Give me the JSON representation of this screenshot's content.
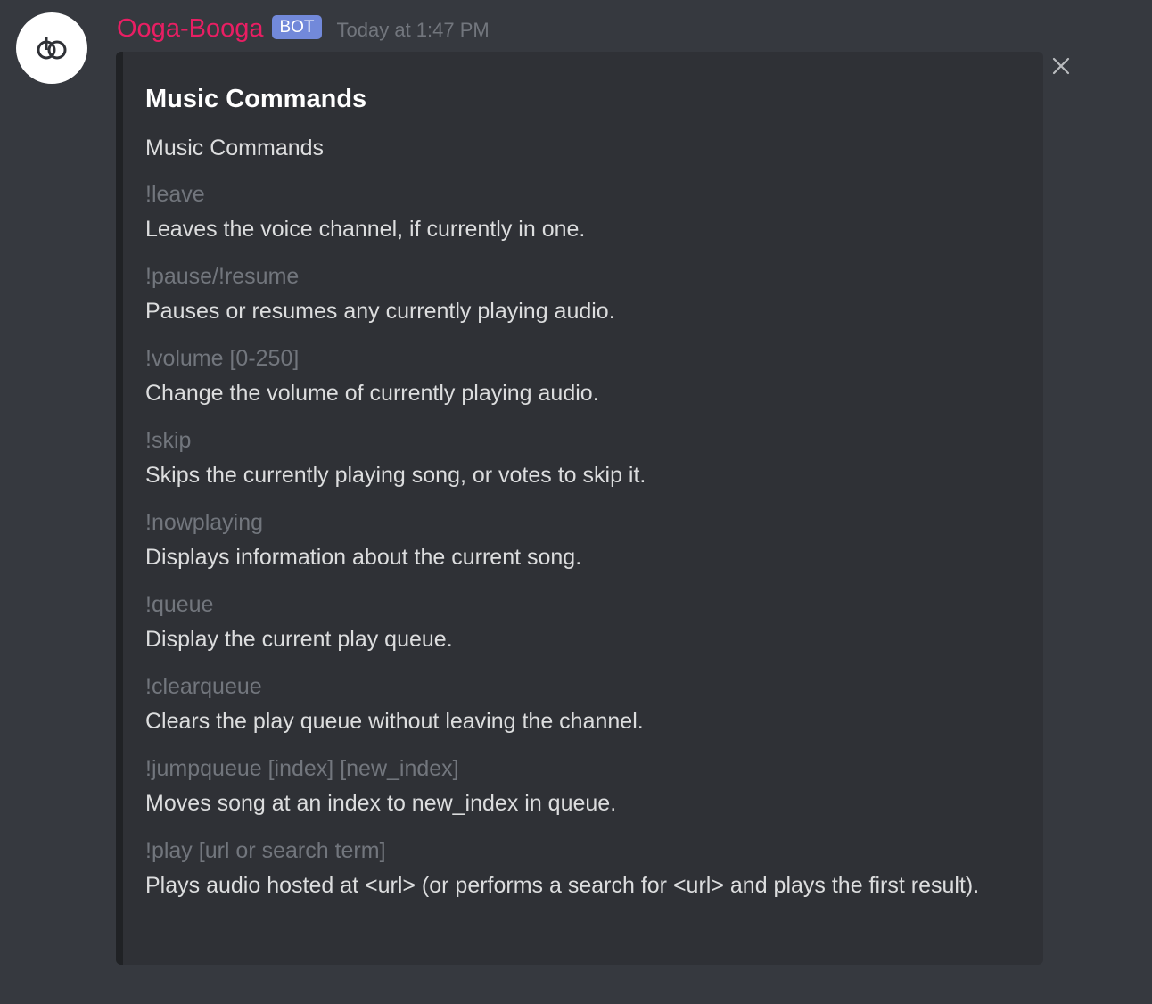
{
  "message": {
    "author": {
      "username": "Ooga-Booga",
      "tag": "BOT",
      "avatar_icon": "linked-rings-logo-icon",
      "username_color": "#e91e63",
      "tag_color": "#7289da"
    },
    "timestamp": "Today at 1:47 PM"
  },
  "embed": {
    "title": "Music Commands",
    "description": "Music Commands",
    "fields": [
      {
        "name": "!leave",
        "value": "Leaves the voice channel, if currently in one."
      },
      {
        "name": "!pause/!resume",
        "value": "Pauses or resumes any currently playing audio."
      },
      {
        "name": "!volume [0-250]",
        "value": "Change the volume of currently playing audio."
      },
      {
        "name": "!skip",
        "value": "Skips the currently playing song, or votes to skip it."
      },
      {
        "name": "!nowplaying",
        "value": "Displays information about the current song."
      },
      {
        "name": "!queue",
        "value": "Display the current play queue."
      },
      {
        "name": "!clearqueue",
        "value": "Clears the play queue without leaving the channel."
      },
      {
        "name": "!jumpqueue [index] [new_index]",
        "value": "Moves song at an index to new_index in queue."
      },
      {
        "name": "!play [url or search term]",
        "value": "Plays audio hosted at <url> (or performs a search for <url> and plays the first result)."
      }
    ]
  },
  "controls": {
    "close_icon": "close-icon"
  },
  "theme": {
    "background": "#36393f",
    "embed_background": "#2f3136",
    "embed_bar": "#202225"
  }
}
